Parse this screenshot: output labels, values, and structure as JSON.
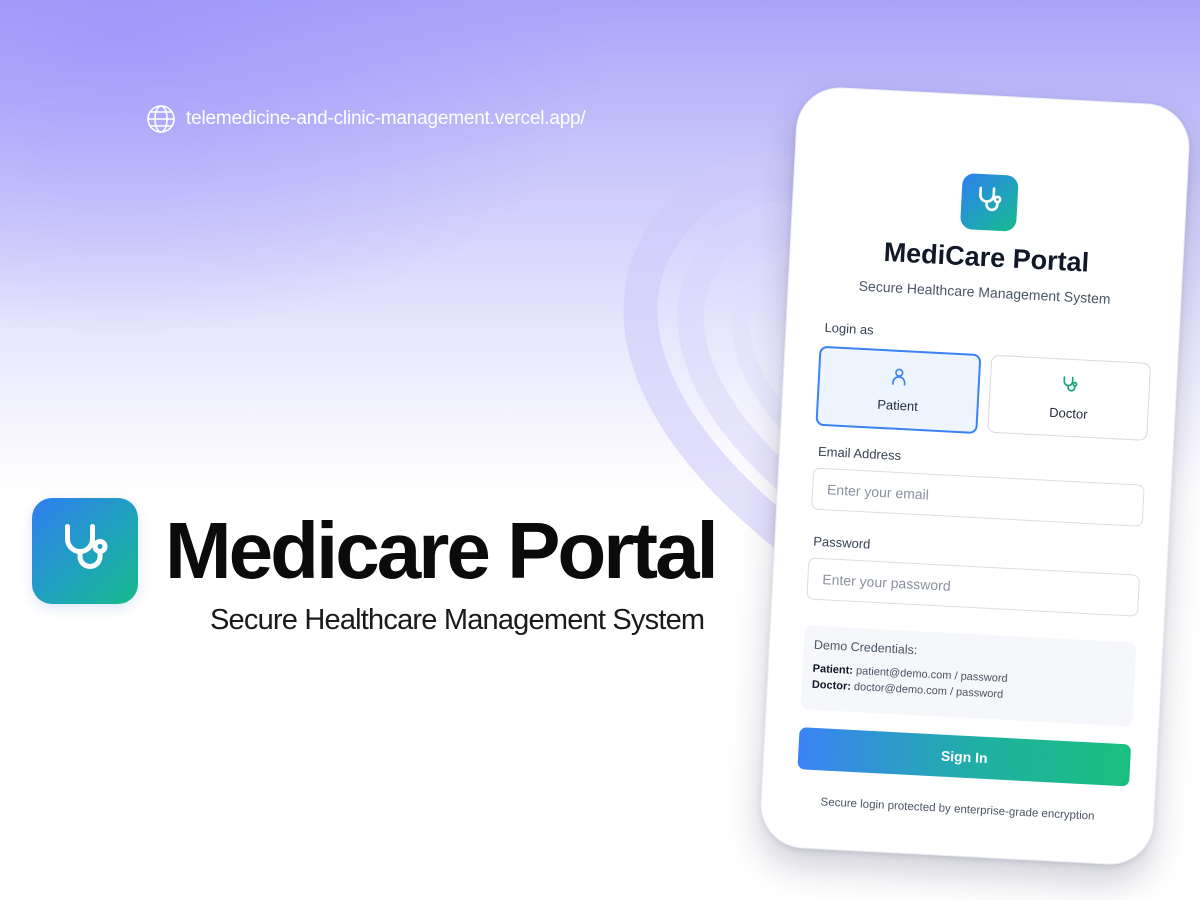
{
  "url": "telemedicine-and-clinic-management.vercel.app/",
  "brand": {
    "title": "Medicare Portal",
    "subtitle": "Secure Healthcare Management System",
    "logo_icon": "stethoscope-icon"
  },
  "app": {
    "title": "MediCare Portal",
    "subtitle": "Secure Healthcare Management System",
    "login_as_label": "Login as",
    "roles": [
      {
        "label": "Patient",
        "icon": "user-icon",
        "selected": true
      },
      {
        "label": "Doctor",
        "icon": "stethoscope-icon",
        "selected": false
      }
    ],
    "email": {
      "label": "Email Address",
      "placeholder": "Enter your email",
      "value": ""
    },
    "password": {
      "label": "Password",
      "placeholder": "Enter your password",
      "value": ""
    },
    "demo": {
      "title": "Demo Credentials:",
      "patient_label": "Patient:",
      "patient_value": "patient@demo.com / password",
      "doctor_label": "Doctor:",
      "doctor_value": "doctor@demo.com / password"
    },
    "sign_in_label": "Sign In",
    "footer_note": "Secure login protected by enterprise-grade encryption"
  },
  "colors": {
    "primary_blue": "#3b82f6",
    "accent_green": "#16b98a",
    "background_purple": "#a9a4f8"
  }
}
